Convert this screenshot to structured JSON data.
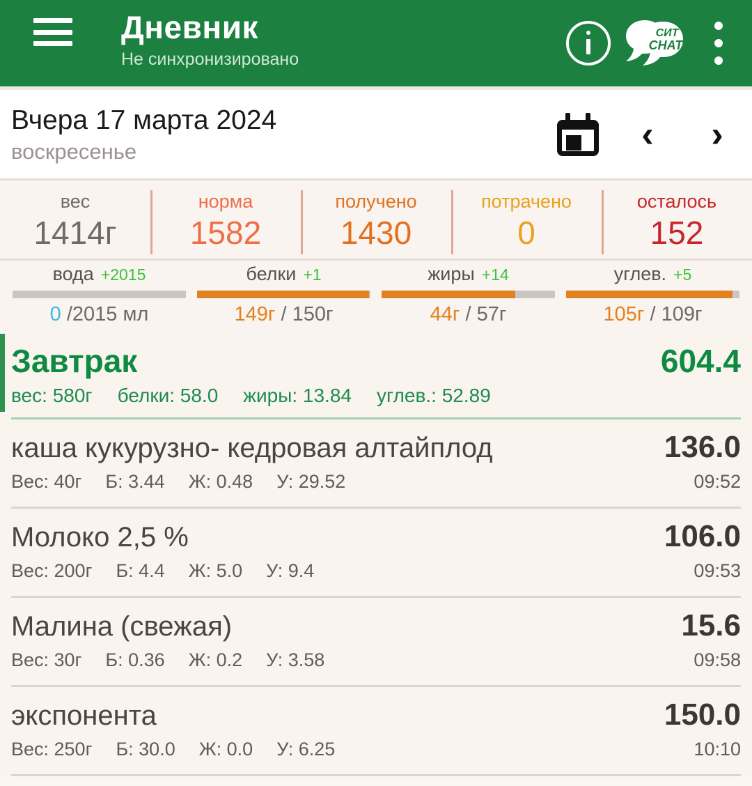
{
  "header": {
    "menu_icon": "hamburger-menu-icon",
    "title": "Дневник",
    "subtitle": "Не синхронизировано",
    "info_icon": "info-icon",
    "chat_logo_line1": "СИТ",
    "chat_logo_line2": "CHAT",
    "overflow_icon": "kebab-menu-icon",
    "bg_color": "#1B8040"
  },
  "date_bar": {
    "date_main": "Вчера 17 марта 2024",
    "weekday": "воскресенье",
    "calendar_icon": "calendar-icon",
    "prev_label": "‹",
    "next_label": "›"
  },
  "summary": {
    "cells": [
      {
        "label": "вес",
        "value": "1414г",
        "color": "#6E6A68"
      },
      {
        "label": "норма",
        "value": "1582",
        "color": "#EE6E48"
      },
      {
        "label": "получено",
        "value": "1430",
        "color": "#E2701E"
      },
      {
        "label": "потрачено",
        "value": "0",
        "color": "#E8A21C"
      },
      {
        "label": "осталось",
        "value": "152",
        "color": "#C8252B"
      }
    ],
    "macros": [
      {
        "name": "вода",
        "delta": "+2015",
        "current": "0",
        "target": "/2015 мл",
        "percent": 0,
        "accent": "#3FB8E8"
      },
      {
        "name": "белки",
        "delta": "+1",
        "current": "149г",
        "target": "/ 150г",
        "percent": 99,
        "accent": "#E2821E"
      },
      {
        "name": "жиры",
        "delta": "+14",
        "current": "44г",
        "target": "/ 57г",
        "percent": 77,
        "accent": "#E2821E"
      },
      {
        "name": "углев.",
        "delta": "+5",
        "current": "105г",
        "target": "/ 109г",
        "percent": 96,
        "accent": "#E2821E"
      }
    ]
  },
  "meal": {
    "name": "Завтрак",
    "kcal": "604.4",
    "weight": "вес: 580г",
    "protein": "белки: 58.0",
    "fat": "жиры: 13.84",
    "carbs": "углев.: 52.89",
    "accent_color": "#0E8A42"
  },
  "foods": [
    {
      "name": "каша кукурузно- кедровая  алтайплод",
      "kcal": "136.0",
      "weight": "Вес: 40г",
      "protein": "Б: 3.44",
      "fat": "Ж: 0.48",
      "carbs": "У: 29.52",
      "time": "09:52"
    },
    {
      "name": "Молоко 2,5 %",
      "kcal": "106.0",
      "weight": "Вес: 200г",
      "protein": "Б: 4.4",
      "fat": "Ж: 5.0",
      "carbs": "У: 9.4",
      "time": "09:53"
    },
    {
      "name": "Малина (свежая)",
      "kcal": "15.6",
      "weight": "Вес: 30г",
      "protein": "Б: 0.36",
      "fat": "Ж: 0.2",
      "carbs": "У: 3.58",
      "time": "09:58"
    },
    {
      "name": "экспонента",
      "kcal": "150.0",
      "weight": "Вес: 250г",
      "protein": "Б: 30.0",
      "fat": "Ж: 0.0",
      "carbs": "У: 6.25",
      "time": "10:10"
    }
  ]
}
